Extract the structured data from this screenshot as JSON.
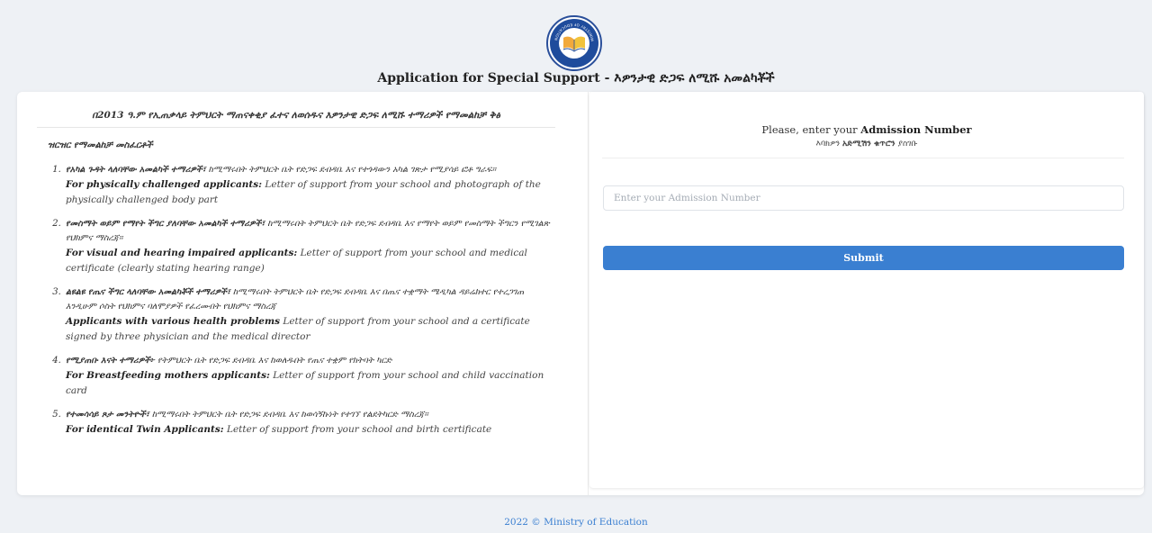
{
  "header": {
    "logo_text": "MINISTRY OF EDUCATION",
    "title": "Application for Special Support - እዎንታዊ ድጋፍ ለሚሹ አመልካቾች"
  },
  "left": {
    "heading": "በ2013 ዓ.ም የኢጠቃላይ ትምህርት ማጠናቀቂያ ፈተና ለወሰዱና እዎንታዊ ድጋፍ ለሚሹ ተማሪዎች የማመልከቻ ቅፅ",
    "instructions_label": "ዝርዝር የማመልከቻ መስፈርቶች",
    "requirements": [
      {
        "am_bold": "የአካል ጉዳት ላለባቸው አመልካች ተማሪዎች፣",
        "am_text": " ከሚማሩበት ትምህርት ቤት የድጋፍ ደብዳቤ እና የተጎዳውን አካል ገጽታ የሚያሳይ ፎቶ ግራፍ።",
        "en_bold": "For physically challenged applicants:",
        "en_text": " Letter of support from your school and photograph of the physically challenged body part"
      },
      {
        "am_bold": "የመስማት ወይም የማየት ችግር ያለባቸው አመልካች ተማሪዎች፣",
        "am_text": " ከሚማሩበት ትምህርት ቤት የድጋፍ ደብዳቤ እና የማየት ወይም የመስማት ችግርን የሚገልጽ የህክምና ማስረጃ።",
        "en_bold": "For visual and hearing impaired applicants:",
        "en_text": " Letter of support from your school and medical certificate (clearly stating hearing range)"
      },
      {
        "am_bold": "ልዩልዩ የጤና ችግር ላለባቸው አመልካቾች ተማሪዎች፣",
        "am_text": " ከሚማሩበት ትምህርት ቤት የድጋፍ ደብዳቤ እና በጤና ተቋማት ሜዲካል ዳይሬክተር የተረጋገጠ እንዲሁም ሶስት የህክምና ባለሞያዎች የፈረሙበት የህክምና ማስረጃ",
        "en_bold": "Applicants with various health problems",
        "en_text": " Letter of support from your school and a certificate signed by three physician and the medical director"
      },
      {
        "am_bold": "የሚያጠቡ እናት ተማሪዎች፦",
        "am_text": " የትምህርት ቤት የድጋፍ ደብዳቤ እና ከወለዱበት የጤና ተቋም የክትባት ካርድ",
        "en_bold": "For Breastfeeding mothers applicants:",
        "en_text": " Letter of support from your school and child vaccination card"
      },
      {
        "am_bold": "የተመሳሳይ ጾታ መንትዮች፣",
        "am_text": " ከሚማሩበት ትምህርት ቤት የድጋፍ ደብዳቤ እና ከወሳኝኩነት የተገኘ የልደትካርድ ማስረጃ።",
        "en_bold": "For identical Twin Applicants:",
        "en_text": " Letter of support from your school and birth certificate"
      }
    ]
  },
  "right": {
    "prompt_prefix": "Please, enter your ",
    "prompt_bold": "Admission Number",
    "prompt_am_prefix": "እባክዎን ",
    "prompt_am_bold": "አድሚሽን ቁጥሮን",
    "prompt_am_suffix": " ያስገቡ",
    "input_placeholder": "Enter your Admission Number",
    "input_value": "",
    "submit_label": "Submit"
  },
  "footer": {
    "text": "2022 © Ministry of Education"
  },
  "colors": {
    "accent": "#3a7fd1",
    "background": "#eef1f5",
    "logo_blue": "#1f4c9c"
  }
}
